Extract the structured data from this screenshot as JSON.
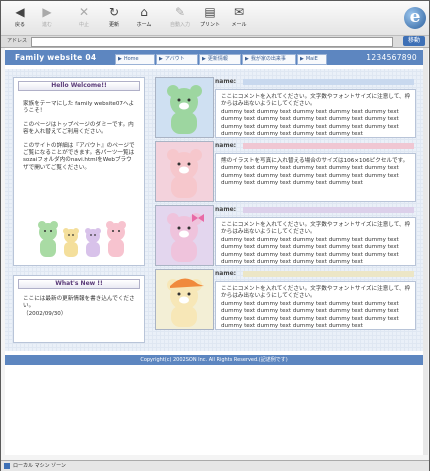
{
  "toolbar": {
    "buttons": [
      {
        "label": "戻る",
        "icon": "back-icon"
      },
      {
        "label": "進む",
        "icon": "forward-icon"
      },
      {
        "label": "中止",
        "icon": "stop-icon"
      },
      {
        "label": "更新",
        "icon": "refresh-icon"
      },
      {
        "label": "ホーム",
        "icon": "home-icon"
      },
      {
        "label": "自動入力",
        "icon": "autofill-icon"
      },
      {
        "label": "プリント",
        "icon": "print-icon"
      },
      {
        "label": "メール",
        "icon": "mail-icon"
      }
    ]
  },
  "address": {
    "label": "アドレス",
    "value": "",
    "go": "移動"
  },
  "header": {
    "title": "Family website 04",
    "phone": "1234567890",
    "nav": [
      "Home",
      "アバウト",
      "更新情報",
      "我が家の出来事",
      "MaiE"
    ]
  },
  "welcome": {
    "heading": "Hello Welcome!!",
    "paragraphs": [
      "家族をテーマにした family website07へようこそ！",
      "このページはトップページのダミーです。内容を入れ替えてご利用ください。",
      "このサイトの詳細は『アバウト』のページでご覧になることができます。各パーツ一覧はsozaiフォルダ内のnavi.htmlをWebブラウザで開いてご覧ください。"
    ]
  },
  "news": {
    "heading": "What's New !!",
    "text": "ここには最新の更新情報を書き込んでください。",
    "date": "（2002/09/30）"
  },
  "entries": [
    {
      "name": "name:",
      "text": "ここにコメントを入れてください。文字数やフォントサイズに注意して、枠からはみ出ないようにしてください。\ndummy text dummy text dummy text dummy text dummy text dummy text dummy text dummy text dummy text dummy text dummy text dummy text dummy text dummy text dummy text dummy text dummy text dummy text dummy text",
      "bg": "#cfe0f2",
      "bar": "#c8d8ee",
      "bear": "#9dd6a0"
    },
    {
      "name": "name:",
      "text": "熊のイラストを写真に入れ替える場合のサイズは106×106ピクセルです。\ndummy text dummy text dummy text dummy text dummy text dummy text dummy text dummy text dummy text dummy text dummy text dummy text dummy text dummy text",
      "bg": "#f3d2dc",
      "bar": "#f0c7d3",
      "bear": "#f6c7cc"
    },
    {
      "name": "name:",
      "text": "ここにコメントを入れてください。文字数やフォントサイズに注意して、枠からはみ出ないようにしてください。\ndummy text dummy text dummy text dummy text dummy text dummy text dummy text dummy text dummy text dummy text dummy text dummy text dummy text dummy text dummy text dummy text dummy text dummy text dummy text",
      "bg": "#e3d6ee",
      "bar": "#dcd0ea",
      "bear": "#efc3dc"
    },
    {
      "name": "name:",
      "text": "ここにコメントを入れてください。文字数やフォントサイズに注意して、枠からはみ出ないようにしてください。\ndummy text dummy text dummy text dummy text dummy text dummy text dummy text dummy text dummy text dummy text dummy text dummy text dummy text dummy text dummy text dummy text dummy text dummy text dummy text",
      "bg": "#f3efd6",
      "bar": "#ece6c6",
      "bear": "#f7e7b7"
    }
  ],
  "footer": "Copyright(c) 2002SON Inc. All Rights Reserved.(記述例です)",
  "status": "ローカル マシン ゾーン",
  "colors": {
    "header": "#5d86c0",
    "accent": "#5a3a78"
  }
}
